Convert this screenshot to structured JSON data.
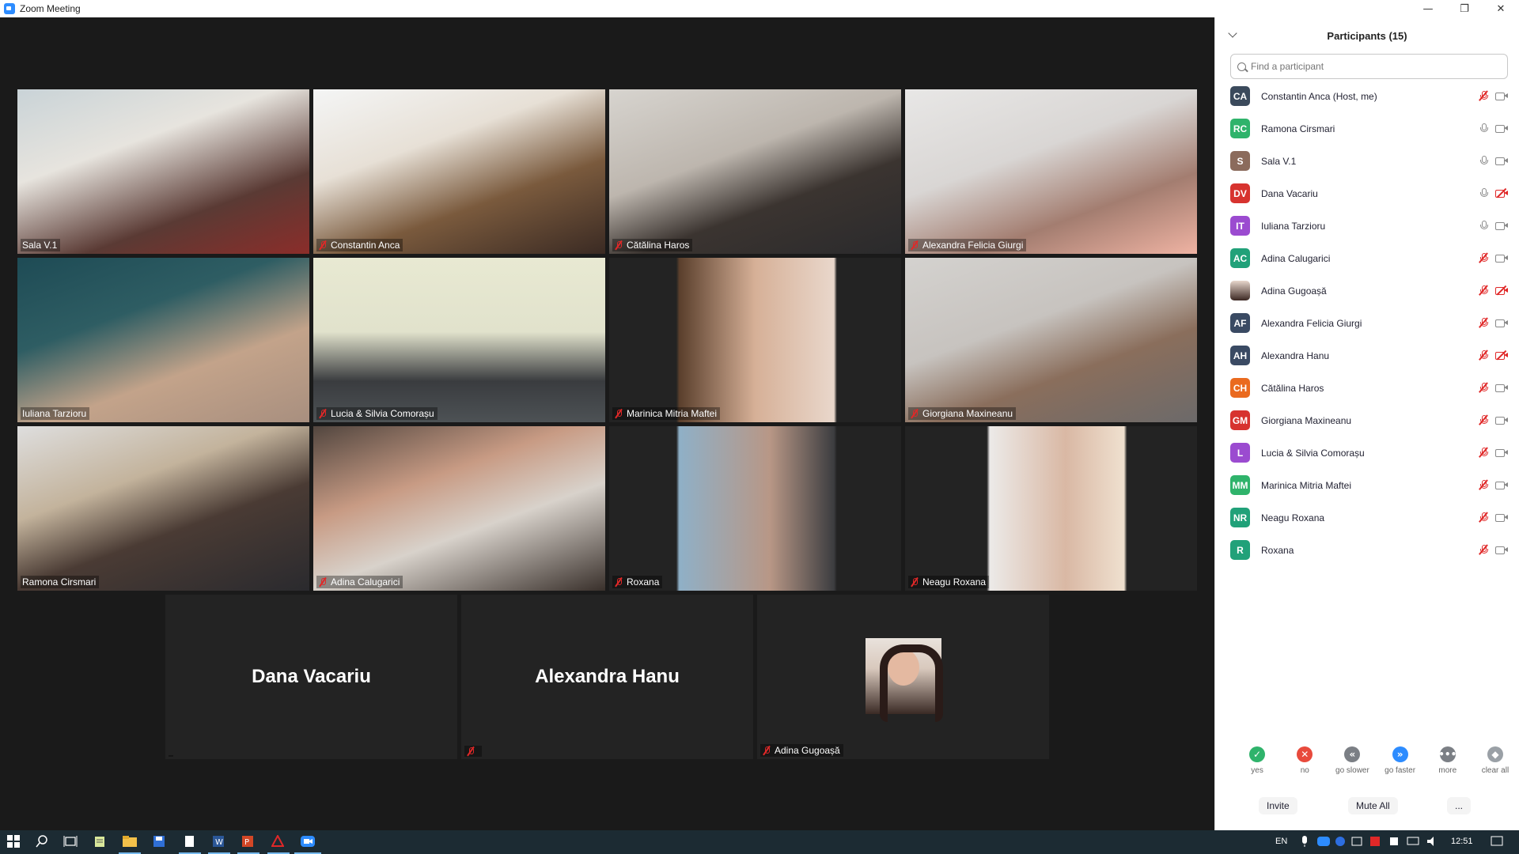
{
  "window": {
    "title": "Zoom Meeting",
    "minimize": "—",
    "restore": "❐",
    "close": "✕"
  },
  "tiles": [
    {
      "name": "Sala V.1",
      "muted": false,
      "active": false,
      "bg": "linear-gradient(160deg,#c9d3d7 0%,#e7e4de 35%,#5a3a34 70%,#8b2d2a 100%)"
    },
    {
      "name": "Constantin Anca",
      "muted": true,
      "active": false,
      "bg": "linear-gradient(160deg,#f4f5f5 0%,#e7e0d6 35%,#7a5a3d 65%,#3a2a23 100%)"
    },
    {
      "name": "Cătălina Haros",
      "muted": true,
      "active": false,
      "bg": "linear-gradient(160deg,#d7d4cf 0%,#bdb6ae 40%,#3b3430 65%,#2a2a2c 100%)"
    },
    {
      "name": "Alexandra Felicia Giurgi",
      "muted": true,
      "active": false,
      "bg": "linear-gradient(160deg,#e8e7e6 0%,#d9d6d4 40%,#a37d70 70%,#efb3a3 100%)"
    },
    {
      "name": "Iuliana Tarzioru",
      "muted": false,
      "active": false,
      "bg": "linear-gradient(160deg,#1e4b55 0%,#2e5d63 35%,#c3a38a 65%,#a88f7f 100%)"
    },
    {
      "name": "Lucia & Silvia Comorașu",
      "muted": true,
      "active": false,
      "bg": "linear-gradient(180deg,#e8e9d2 0%,#e1e2cc 45%,#3a3c3f 75%,#4d5255 100%)"
    },
    {
      "name": "Marinica Mitria Maftei",
      "muted": true,
      "active": false,
      "bg": "linear-gradient(90deg,#232323 0%,#232323 23%,#5a3f2c 24%,#d6b097 50%,#e9d7cb 77%,#232323 78%)"
    },
    {
      "name": "Giorgiana Maxineanu",
      "muted": true,
      "active": false,
      "bg": "linear-gradient(160deg,#d4d2cf 0%,#c7c3bf 40%,#8a6e5c 65%,#6c6a6a 100%)"
    },
    {
      "name": "Ramona Cirsmari",
      "muted": false,
      "active": true,
      "bg": "linear-gradient(160deg,#dedede 0%,#c3b39c 35%,#4a3b34 60%,#2a2a2e 100%)"
    },
    {
      "name": "Adina Calugarici",
      "muted": true,
      "active": false,
      "bg": "linear-gradient(160deg,#52463f 0%,#c89b84 35%,#d8d2cb 60%,#39302b 100%)"
    },
    {
      "name": "Roxana",
      "muted": true,
      "active": false,
      "bg": "linear-gradient(90deg,#232323 0%,#232323 23%,#8fb0c7 24%,#b89786 55%,#3c3d40 77%,#232323 78%)"
    },
    {
      "name": "Neagu Roxana",
      "muted": true,
      "active": false,
      "bg": "linear-gradient(90deg,#232323 0%,#232323 28%,#eceae8 29%,#d9b8a4 55%,#efe0cf 75%,#232323 76%)"
    }
  ],
  "bottom_tiles": [
    {
      "bigname": "Dana Vacariu",
      "name": "",
      "muted": false
    },
    {
      "bigname": "Alexandra Hanu",
      "name": "",
      "muted": true
    },
    {
      "bigname": "",
      "name": "Adina Gugoașă",
      "muted": true
    }
  ],
  "panel": {
    "title": "Participants (15)",
    "search_placeholder": "Find a participant",
    "participants": [
      {
        "initials": "CA",
        "color": "#3b4a5c",
        "name": "Constantin Anca (Host, me)",
        "mic": "off",
        "cam": "on"
      },
      {
        "initials": "RC",
        "color": "#2fb36b",
        "name": "Ramona Cirsmari",
        "mic": "on",
        "cam": "on"
      },
      {
        "initials": "S",
        "color": "#8b6b5c",
        "name": "Sala V.1",
        "mic": "on",
        "cam": "on"
      },
      {
        "initials": "DV",
        "color": "#d7332f",
        "name": "Dana Vacariu",
        "mic": "on",
        "cam": "off"
      },
      {
        "initials": "IT",
        "color": "#9b4bd0",
        "name": "Iuliana Tarzioru",
        "mic": "on",
        "cam": "on"
      },
      {
        "initials": "AC",
        "color": "#21a179",
        "name": "Adina Calugarici",
        "mic": "off",
        "cam": "on"
      },
      {
        "initials": "",
        "color": "photo",
        "name": "Adina Gugoașă",
        "mic": "off",
        "cam": "off"
      },
      {
        "initials": "AF",
        "color": "#3a4a63",
        "name": "Alexandra Felicia Giurgi",
        "mic": "off",
        "cam": "on"
      },
      {
        "initials": "AH",
        "color": "#3a4a63",
        "name": "Alexandra Hanu",
        "mic": "off",
        "cam": "off"
      },
      {
        "initials": "CH",
        "color": "#ea6a1f",
        "name": "Cătălina Haros",
        "mic": "off",
        "cam": "on"
      },
      {
        "initials": "GM",
        "color": "#d7332f",
        "name": "Giorgiana Maxineanu",
        "mic": "off",
        "cam": "on"
      },
      {
        "initials": "L",
        "color": "#9b4bd0",
        "name": "Lucia & Silvia Comorașu",
        "mic": "off",
        "cam": "on"
      },
      {
        "initials": "MM",
        "color": "#2fb36b",
        "name": "Marinica Mitria Maftei",
        "mic": "off",
        "cam": "on"
      },
      {
        "initials": "NR",
        "color": "#21a179",
        "name": "Neagu Roxana",
        "mic": "off",
        "cam": "on"
      },
      {
        "initials": "R",
        "color": "#21a179",
        "name": "Roxana",
        "mic": "off",
        "cam": "on"
      }
    ],
    "feedback": [
      {
        "icon": "✓",
        "color": "#2fb36b",
        "label": "yes",
        "name": "yes-icon"
      },
      {
        "icon": "✕",
        "color": "#e84a3c",
        "label": "no",
        "name": "no-icon"
      },
      {
        "icon": "«",
        "color": "#7b7f85",
        "label": "go slower",
        "name": "go-slower-icon"
      },
      {
        "icon": "»",
        "color": "#2d8cff",
        "label": "go faster",
        "name": "go-faster-icon"
      },
      {
        "icon": "•••",
        "color": "#7b7f85",
        "label": "more",
        "name": "more-icon"
      },
      {
        "icon": "◆",
        "color": "#9aa0a6",
        "label": "clear all",
        "name": "clear-all-icon"
      }
    ],
    "invite_label": "Invite",
    "mute_all_label": "Mute All",
    "more_label": "..."
  },
  "taskbar": {
    "lang": "EN",
    "clock": "12:51"
  }
}
